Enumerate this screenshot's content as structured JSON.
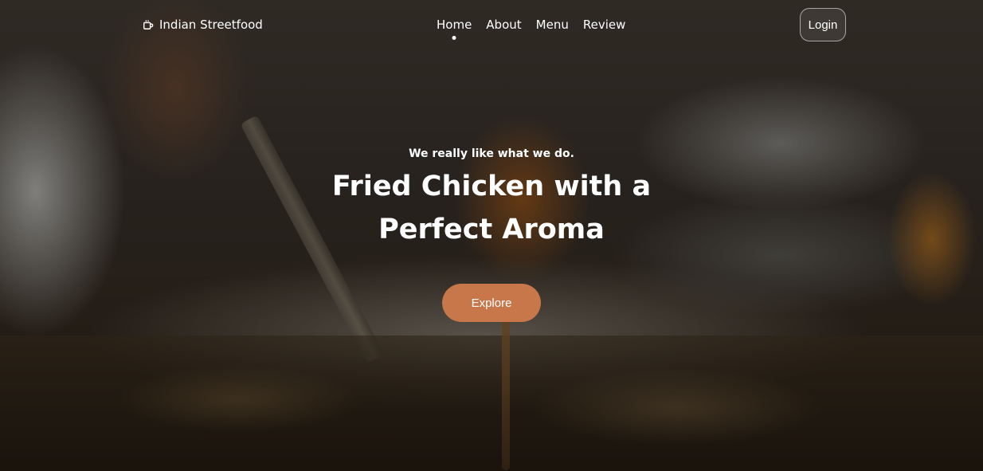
{
  "brand": {
    "icon": "coffee-cup-icon",
    "name": "Indian Streetfood"
  },
  "nav": {
    "links": [
      "Home",
      "About",
      "Menu",
      "Review"
    ],
    "active": "Home"
  },
  "login_label": "Login",
  "hero": {
    "tagline": "We really like what we do.",
    "headline": "Fried Chicken with a Perfect Aroma",
    "cta_label": "Explore"
  },
  "colors": {
    "accent": "#c8774a",
    "text": "#ffffff"
  }
}
